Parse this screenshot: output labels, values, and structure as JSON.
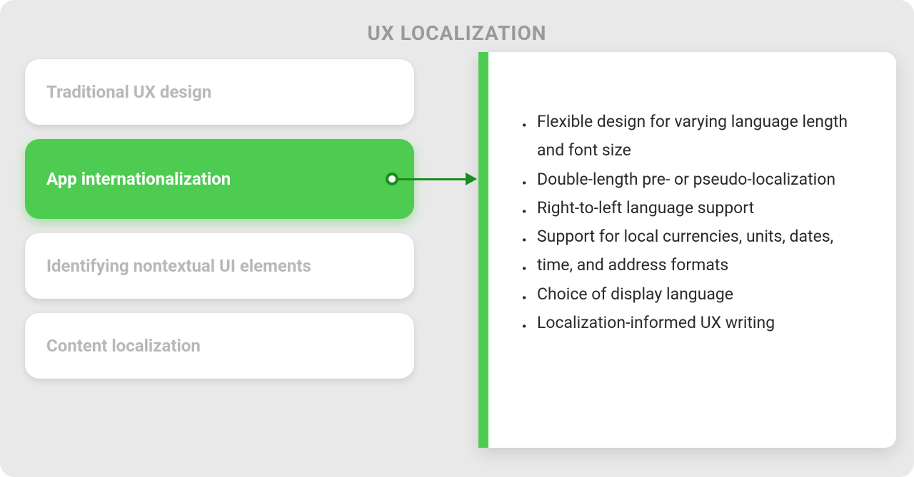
{
  "heading": "UX LOCALIZATION",
  "tabs": [
    {
      "label": "Traditional UX design",
      "active": false
    },
    {
      "label": "App internationalization",
      "active": true
    },
    {
      "label": "Identifying nontextual UI elements",
      "active": false
    },
    {
      "label": "Content localization",
      "active": false
    }
  ],
  "details": [
    "Flexible design for varying language length and font size",
    "Double-length pre- or pseudo-localization",
    "Right-to-left language support",
    "Support for local currencies, units, dates,",
    "time, and address formats",
    "Choice of display language",
    "Localization-informed UX writing"
  ]
}
